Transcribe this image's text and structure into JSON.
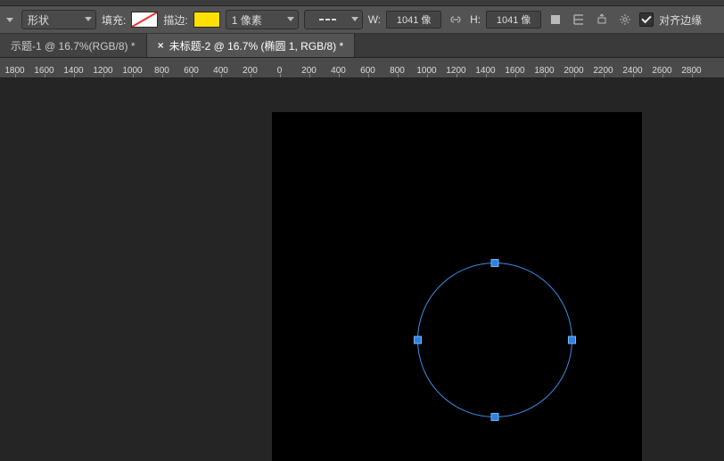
{
  "optionsBar": {
    "mode": "形状",
    "fillLabel": "填充:",
    "strokeLabel": "描边:",
    "strokeWidth": "1 像素",
    "wLabel": "W:",
    "hLabel": "H:",
    "wValue": "1041 像",
    "hValue": "1041 像",
    "alignEdgesLabel": "对齐边缘"
  },
  "tabs": [
    {
      "label": "示题-1 @ 16.7%(RGB/8) *",
      "active": false
    },
    {
      "label": "未标题-2 @ 16.7% (椭圆 1, RGB/8) *",
      "active": true
    }
  ],
  "ruler": {
    "ticks": [
      "1800",
      "1600",
      "1400",
      "1200",
      "1000",
      "800",
      "600",
      "400",
      "200",
      "0",
      "200",
      "400",
      "600",
      "800",
      "1000",
      "1200",
      "1400",
      "1600",
      "1800",
      "2000",
      "2200",
      "2400",
      "2600",
      "2800"
    ]
  }
}
